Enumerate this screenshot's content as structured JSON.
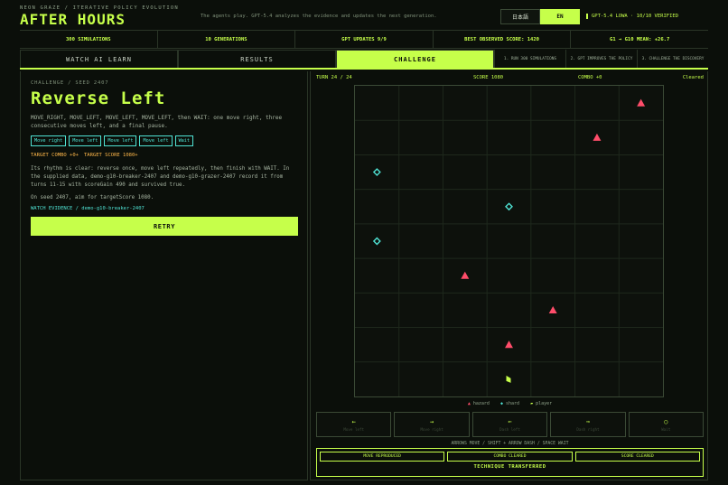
{
  "brand": {
    "subtitle": "NEON GRAZE / ITERATIVE POLICY EVOLUTION",
    "title": "AFTER HOURS",
    "tagline": "The agents play. GPT-5.4 analyzes the evidence and updates the next generation."
  },
  "lang": {
    "ja": "日本語",
    "en": "EN"
  },
  "model_badge": "GPT-5.4 LOWA · 10/10 VERIFIED",
  "stats": [
    "300 SIMULATIONS",
    "10 GENERATIONS",
    "GPT UPDATES 9/9",
    "BEST OBSERVED SCORE: 1420",
    "G1 → G10 MEAN: +26.7"
  ],
  "nav": {
    "tabs": [
      "WATCH AI LEARN",
      "RESULTS",
      "CHALLENGE"
    ],
    "steps": [
      "1. RUN 300 SIMULATIONS",
      "2. GPT IMPROVES THE POLICY",
      "3. CHALLENGE THE DISCOVERY"
    ]
  },
  "challenge": {
    "crumb": "CHALLENGE / SEED 2407",
    "title": "Reverse Left",
    "moves_desc": "MOVE_RIGHT, MOVE_LEFT, MOVE_LEFT, MOVE_LEFT, then WAIT: one move right, three consecutive moves left, and a final pause.",
    "chips": [
      "Move right",
      "Move left",
      "Move left",
      "Move left",
      "Wait"
    ],
    "target_combo": "TARGET COMBO +0+",
    "target_score": "TARGET SCORE 1080+",
    "description": "Its rhythm is clear: reverse once, move left repeatedly, then finish with WAIT. In the supplied data, demo-g10-breaker-2407 and demo-g10-grazer-2407 record it from turns 11-15 with scoreGain 490 and survived true.",
    "seed_line": "On seed 2407, aim for targetScore 1080.",
    "evidence": "WATCH EVIDENCE / demo-g10-breaker-2407",
    "retry": "RETRY"
  },
  "game": {
    "turn": "TURN 24 / 24",
    "score": "SCORE 1080",
    "combo": "COMBO +0",
    "status": "Cleared",
    "grid": {
      "cols": 7,
      "rows": 9
    },
    "entities": [
      {
        "kind": "hazard",
        "col": 6,
        "row": 0
      },
      {
        "kind": "hazard",
        "col": 5,
        "row": 1
      },
      {
        "kind": "shard",
        "col": 0,
        "row": 2
      },
      {
        "kind": "shard",
        "col": 3,
        "row": 3
      },
      {
        "kind": "shard",
        "col": 0,
        "row": 4
      },
      {
        "kind": "hazard",
        "col": 2,
        "row": 5
      },
      {
        "kind": "hazard",
        "col": 4,
        "row": 6
      },
      {
        "kind": "hazard",
        "col": 3,
        "row": 7
      },
      {
        "kind": "player",
        "col": 3,
        "row": 8
      }
    ],
    "legend": {
      "hazard": "hazard",
      "shard": "shard",
      "player": "player"
    },
    "controls": [
      {
        "glyph": "←",
        "caption": "Move left"
      },
      {
        "glyph": "→",
        "caption": "Move right"
      },
      {
        "glyph": "⇐",
        "caption": "Dash left"
      },
      {
        "glyph": "⇒",
        "caption": "Dash right"
      },
      {
        "glyph": "○",
        "caption": "Wait"
      }
    ],
    "hint": "ARROWS MOVE / SHIFT + ARROW DASH / SPACE WAIT",
    "result_chips": [
      "MOVE REPRODUCED",
      "COMBO CLEARED",
      "SCORE CLEARED"
    ],
    "transferred": "TECHNIQUE TRANSFERRED"
  },
  "colors": {
    "accent": "#c6ff4a",
    "hazard": "#ff4d6a",
    "shard": "#4fe3d4",
    "warn": "#ffb84a"
  }
}
